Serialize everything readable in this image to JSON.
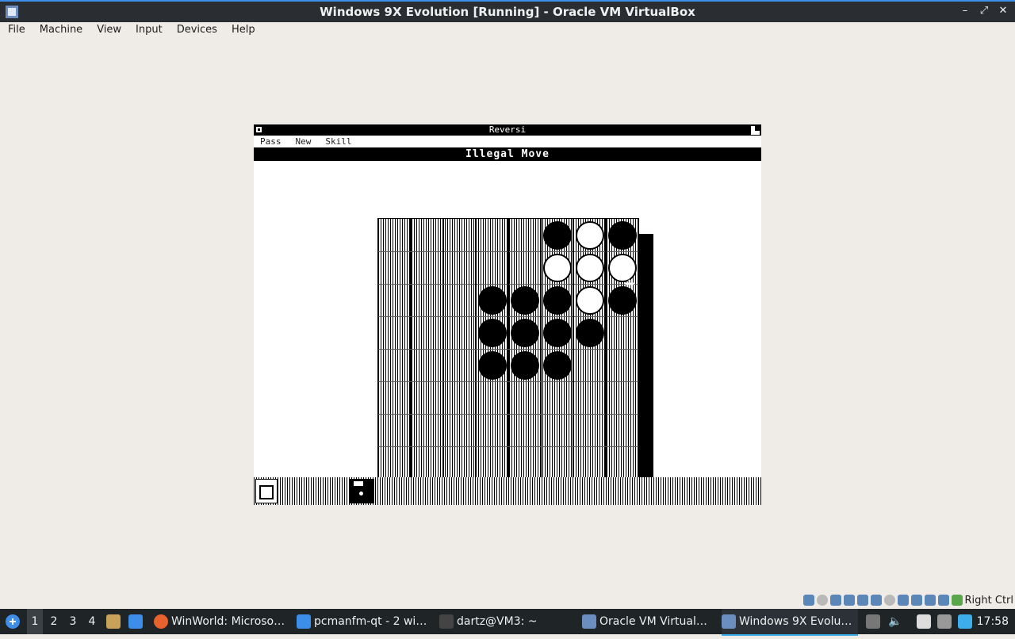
{
  "window": {
    "title": "Windows 9X Evolution [Running] - Oracle VM VirtualBox",
    "controls": [
      "–",
      "⤢",
      "✕"
    ]
  },
  "menubar": {
    "items": [
      "File",
      "Machine",
      "View",
      "Input",
      "Devices",
      "Help"
    ]
  },
  "reversi": {
    "title": "Reversi",
    "menu": [
      "Pass",
      "New",
      "Skill"
    ],
    "status": "Illegal Move",
    "board_size": 8,
    "discs": [
      {
        "row": 0,
        "col": 5,
        "color": "black"
      },
      {
        "row": 0,
        "col": 6,
        "color": "white"
      },
      {
        "row": 0,
        "col": 7,
        "color": "black"
      },
      {
        "row": 1,
        "col": 5,
        "color": "white"
      },
      {
        "row": 1,
        "col": 6,
        "color": "white"
      },
      {
        "row": 1,
        "col": 7,
        "color": "white"
      },
      {
        "row": 2,
        "col": 3,
        "color": "black"
      },
      {
        "row": 2,
        "col": 4,
        "color": "black"
      },
      {
        "row": 2,
        "col": 5,
        "color": "black"
      },
      {
        "row": 2,
        "col": 6,
        "color": "white"
      },
      {
        "row": 2,
        "col": 7,
        "color": "black"
      },
      {
        "row": 3,
        "col": 3,
        "color": "black"
      },
      {
        "row": 3,
        "col": 4,
        "color": "black"
      },
      {
        "row": 3,
        "col": 5,
        "color": "black"
      },
      {
        "row": 3,
        "col": 6,
        "color": "black"
      },
      {
        "row": 4,
        "col": 3,
        "color": "black"
      },
      {
        "row": 4,
        "col": 4,
        "color": "black"
      },
      {
        "row": 4,
        "col": 5,
        "color": "black"
      }
    ]
  },
  "vbox_status": {
    "host_key": "Right Ctrl"
  },
  "taskbar": {
    "workspaces": [
      "1",
      "2",
      "3",
      "4"
    ],
    "tasks": [
      "WinWorld: Microso…",
      "pcmanfm-qt - 2 wi…",
      "dartz@VM3: ~",
      "Oracle VM Virtual…",
      "Windows 9X Evolu…"
    ],
    "clock": "17:58"
  }
}
